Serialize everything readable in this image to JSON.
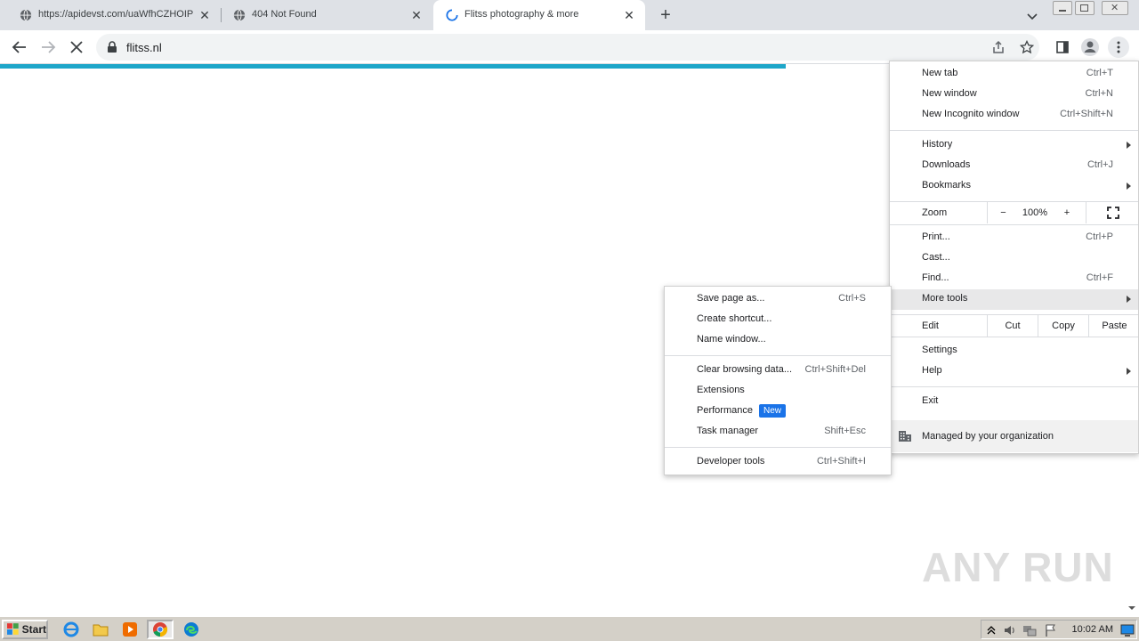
{
  "tabs": [
    {
      "title": "https://apidevst.com/uaWfhCZHOIP",
      "active": false
    },
    {
      "title": "404 Not Found",
      "active": false
    },
    {
      "title": "Flitss photography & more",
      "active": true
    }
  ],
  "toolbar": {
    "url": "flitss.nl"
  },
  "chrome_menu": {
    "items_top": [
      {
        "label": "New tab",
        "shortcut": "Ctrl+T"
      },
      {
        "label": "New window",
        "shortcut": "Ctrl+N"
      },
      {
        "label": "New Incognito window",
        "shortcut": "Ctrl+Shift+N"
      }
    ],
    "items_mid": [
      {
        "label": "History",
        "shortcut": ""
      },
      {
        "label": "Downloads",
        "shortcut": "Ctrl+J"
      },
      {
        "label": "Bookmarks",
        "shortcut": ""
      }
    ],
    "zoom": {
      "label": "Zoom",
      "minus": "−",
      "value": "100%",
      "plus": "+"
    },
    "items_print": [
      {
        "label": "Print...",
        "shortcut": "Ctrl+P"
      },
      {
        "label": "Cast...",
        "shortcut": ""
      },
      {
        "label": "Find...",
        "shortcut": "Ctrl+F"
      },
      {
        "label": "More tools",
        "shortcut": ""
      }
    ],
    "edit": {
      "label": "Edit",
      "cut": "Cut",
      "copy": "Copy",
      "paste": "Paste"
    },
    "items_settings": [
      {
        "label": "Settings",
        "shortcut": ""
      },
      {
        "label": "Help",
        "shortcut": ""
      }
    ],
    "exit": "Exit",
    "managed": "Managed by your organization"
  },
  "more_tools_menu": {
    "group1": [
      {
        "label": "Save page as...",
        "shortcut": "Ctrl+S"
      },
      {
        "label": "Create shortcut...",
        "shortcut": ""
      },
      {
        "label": "Name window...",
        "shortcut": ""
      }
    ],
    "group2": [
      {
        "label": "Clear browsing data...",
        "shortcut": "Ctrl+Shift+Del"
      },
      {
        "label": "Extensions",
        "shortcut": ""
      },
      {
        "label": "Performance",
        "shortcut": ""
      },
      {
        "label": "Task manager",
        "shortcut": "Shift+Esc"
      }
    ],
    "performance_badge": "New",
    "group3": [
      {
        "label": "Developer tools",
        "shortcut": "Ctrl+Shift+I"
      }
    ]
  },
  "watermark": "ANY RUN",
  "taskbar": {
    "start_label": "Start",
    "clock": "10:02 AM"
  },
  "colors": {
    "progress": "#1ea6c9",
    "badge": "#1a73e8",
    "tabstrip": "#dee1e6"
  },
  "page_load_progress": 0.69
}
